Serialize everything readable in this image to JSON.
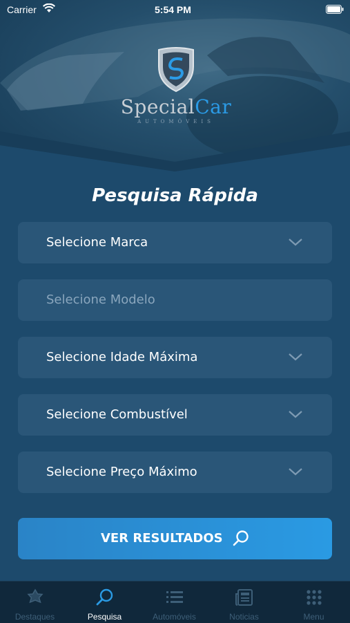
{
  "status_bar": {
    "carrier": "Carrier",
    "time": "5:54 PM"
  },
  "logo": {
    "brand_left": "Special",
    "brand_right": "Car",
    "subtitle": "AUTOMÓVEIS"
  },
  "page_title": "Pesquisa Rápida",
  "selects": [
    {
      "label": "Selecione Marca",
      "disabled": false
    },
    {
      "label": "Selecione Modelo",
      "disabled": true
    },
    {
      "label": "Selecione Idade Máxima",
      "disabled": false
    },
    {
      "label": "Selecione Combustível",
      "disabled": false
    },
    {
      "label": "Selecione Preço Máximo",
      "disabled": false
    }
  ],
  "submit_button": {
    "label": "VER RESULTADOS",
    "icon": "search-icon"
  },
  "tabs": [
    {
      "label": "Destaques",
      "icon": "star-icon",
      "active": false
    },
    {
      "label": "Pesquisa",
      "icon": "search-icon",
      "active": true
    },
    {
      "label": "Automóveis",
      "icon": "list-icon",
      "active": false
    },
    {
      "label": "Noticias",
      "icon": "newspaper-icon",
      "active": false
    },
    {
      "label": "Menu",
      "icon": "grid-icon",
      "active": false
    }
  ],
  "colors": {
    "accent": "#2a9ae3",
    "background": "#1d4a6c",
    "field": "#2a5678",
    "tabbar": "#10283b"
  }
}
